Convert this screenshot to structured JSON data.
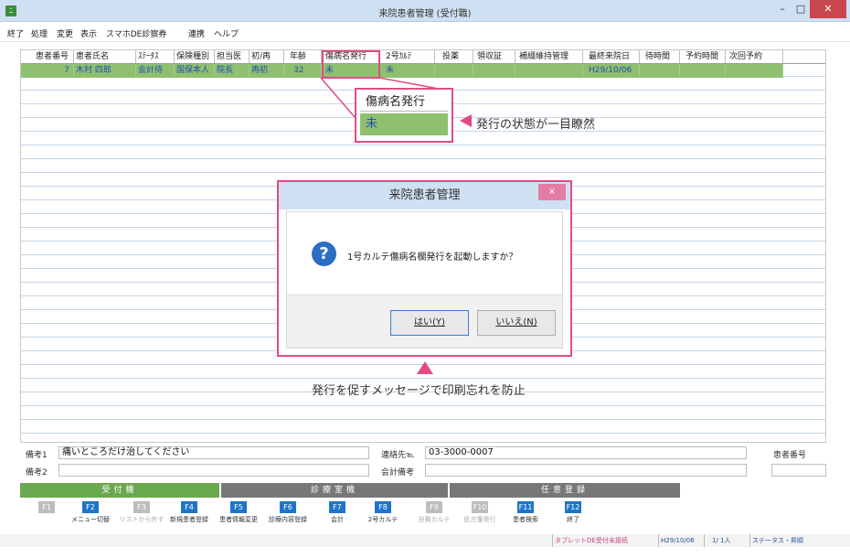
{
  "window": {
    "title": "来院患者管理 (受付職)",
    "icon_label": "ﾆ",
    "min_label": "–",
    "max_label": "□",
    "close_label": "✕"
  },
  "menu": [
    "終了",
    "処理",
    "変更",
    "表示",
    "スマホDE診察券",
    "連携",
    "ヘルプ"
  ],
  "grid": {
    "headers": [
      "患者番号",
      "患者氏名",
      "ｽﾃｰﾀｽ",
      "保険種別",
      "担当医",
      "初/再",
      "年齢",
      "傷病名発行",
      "2号ｶﾙﾃ",
      "投薬",
      "領収証",
      "補綴維持管理",
      "最終来院日",
      "待時間",
      "予約時間",
      "次回予約"
    ],
    "rows": [
      [
        "7",
        "木村 四郎",
        "会計待",
        "国保本人",
        "院長",
        "再初",
        "32",
        "未",
        "未",
        "",
        "",
        "",
        "H29/10/06",
        "",
        "",
        ""
      ]
    ]
  },
  "callout": {
    "header": "傷病名発行",
    "value": "未",
    "annotation": "発行の状態が一目瞭然"
  },
  "dialog": {
    "title": "来院患者管理",
    "close_label": "×",
    "icon": "?",
    "message": "1号カルテ傷病名欄発行を起動しますか？",
    "yes_label": "はい(Y)",
    "no_label": "いいえ(N)"
  },
  "annotation_bottom": "発行を促すメッセージで印刷忘れを防止",
  "bottom": {
    "memo1_label": "備考1",
    "memo1_value": "痛いところだけ治してください",
    "memo2_label": "備考2",
    "memo2_value": "",
    "contact_label": "連絡先℡",
    "contact_value": "03-3000-0007",
    "account_memo_label": "会計備考",
    "account_memo_value": "",
    "patient_no_label": "患者番号",
    "patient_no_value": ""
  },
  "tabs": [
    "受付機",
    "診療室機",
    "任意登録"
  ],
  "fkeys": [
    {
      "key": "F1",
      "label": "",
      "enabled": false
    },
    {
      "key": "F2",
      "label": "メニュー切替",
      "enabled": true
    },
    {
      "key": "F3",
      "label": "リストから外す",
      "enabled": false
    },
    {
      "key": "F4",
      "label": "新規患者登録",
      "enabled": true
    },
    {
      "key": "F5",
      "label": "患者情報変更",
      "enabled": true
    },
    {
      "key": "F6",
      "label": "診療内容登録",
      "enabled": true
    },
    {
      "key": "F7",
      "label": "会計",
      "enabled": true
    },
    {
      "key": "F8",
      "label": "2号カルテ",
      "enabled": true
    },
    {
      "key": "F9",
      "label": "自費カルテ",
      "enabled": false
    },
    {
      "key": "F10",
      "label": "処方箋発行",
      "enabled": false
    },
    {
      "key": "F11",
      "label": "患者検索",
      "enabled": true
    },
    {
      "key": "F12",
      "label": "終了",
      "enabled": true
    }
  ],
  "status": {
    "tablet": "タブレットDE受付未接続",
    "date": "H29/10/06",
    "count": "1/ 1人",
    "mode": "ステータス・昇順"
  },
  "colors": {
    "accent_pink": "#e24a85",
    "row_green": "#8fc070",
    "fkey_blue": "#1e74c8",
    "titlebar": "#cfe0f3"
  }
}
